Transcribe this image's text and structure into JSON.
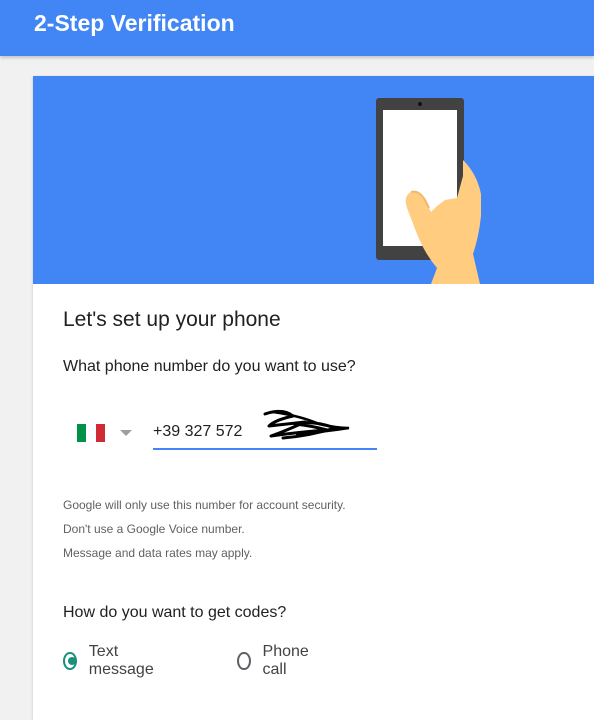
{
  "header": {
    "title": "2-Step Verification"
  },
  "setup": {
    "heading": "Let's set up your phone",
    "question": "What phone number do you want to use?",
    "country_flag": "italy-flag-icon",
    "phone_value": "+39 327 572",
    "notes": [
      "Google will only use this number for account security.",
      "Don't use a Google Voice number.",
      "Message and data rates may apply."
    ]
  },
  "codes": {
    "heading": "How do you want to get codes?",
    "options": [
      {
        "label": "Text message",
        "selected": true
      },
      {
        "label": "Phone call",
        "selected": false
      }
    ]
  },
  "colors": {
    "brand_blue": "#4285f4",
    "radio_selected": "#1a8f7b",
    "flag_green": "#009246",
    "flag_white": "#ffffff",
    "flag_red": "#ce2b37"
  }
}
